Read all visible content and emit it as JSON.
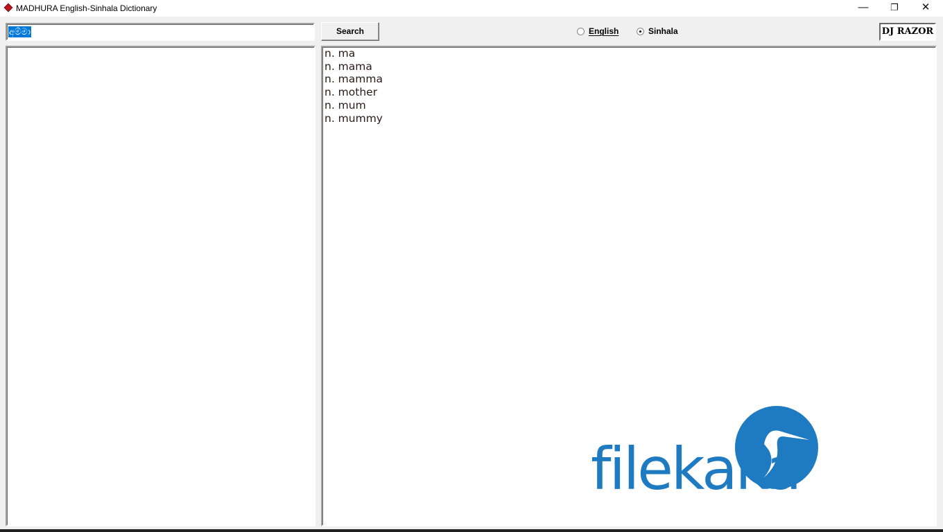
{
  "window": {
    "title": "MADHURA English-Sinhala Dictionary",
    "controls": {
      "minimize": "—",
      "restore": "❐",
      "close": "✕"
    }
  },
  "search": {
    "value": "අම්මා",
    "button_label": "Search"
  },
  "language": {
    "options": [
      {
        "label": "English",
        "selected": false
      },
      {
        "label": "Sinhala",
        "selected": true
      }
    ]
  },
  "badge": "DJ RAZOR",
  "word_list": [],
  "definitions": [
    "n. ma",
    "n. mama",
    "n. mamma",
    "n. mother",
    "n. mum",
    "n. mummy"
  ],
  "watermark": {
    "text": "filekaka",
    "color": "#1f7bc1"
  }
}
